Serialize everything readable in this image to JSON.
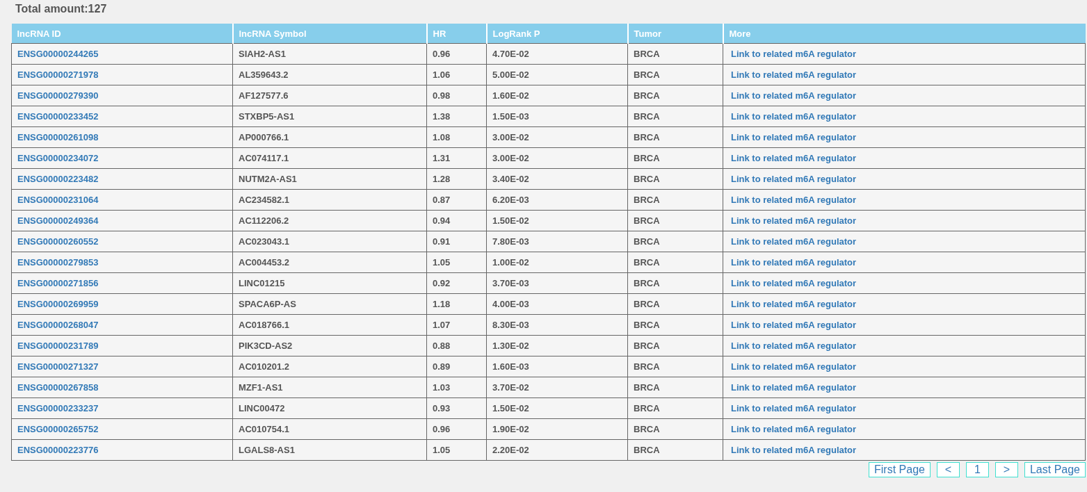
{
  "total_label": "Total amount:127",
  "table": {
    "columns": [
      "lncRNA ID",
      "lncRNA Symbol",
      "HR",
      "LogRank P",
      "Tumor",
      "More"
    ],
    "rows": [
      {
        "id": "ENSG00000244265",
        "symbol": "SIAH2-AS1",
        "hr": "0.96",
        "p": "4.70E-02",
        "tumor": "BRCA",
        "more": "Link to related m6A regulator"
      },
      {
        "id": "ENSG00000271978",
        "symbol": "AL359643.2",
        "hr": "1.06",
        "p": "5.00E-02",
        "tumor": "BRCA",
        "more": "Link to related m6A regulator"
      },
      {
        "id": "ENSG00000279390",
        "symbol": "AF127577.6",
        "hr": "0.98",
        "p": "1.60E-02",
        "tumor": "BRCA",
        "more": "Link to related m6A regulator"
      },
      {
        "id": "ENSG00000233452",
        "symbol": "STXBP5-AS1",
        "hr": "1.38",
        "p": "1.50E-03",
        "tumor": "BRCA",
        "more": "Link to related m6A regulator"
      },
      {
        "id": "ENSG00000261098",
        "symbol": "AP000766.1",
        "hr": "1.08",
        "p": "3.00E-02",
        "tumor": "BRCA",
        "more": "Link to related m6A regulator"
      },
      {
        "id": "ENSG00000234072",
        "symbol": "AC074117.1",
        "hr": "1.31",
        "p": "3.00E-02",
        "tumor": "BRCA",
        "more": "Link to related m6A regulator"
      },
      {
        "id": "ENSG00000223482",
        "symbol": "NUTM2A-AS1",
        "hr": "1.28",
        "p": "3.40E-02",
        "tumor": "BRCA",
        "more": "Link to related m6A regulator"
      },
      {
        "id": "ENSG00000231064",
        "symbol": "AC234582.1",
        "hr": "0.87",
        "p": "6.20E-03",
        "tumor": "BRCA",
        "more": "Link to related m6A regulator"
      },
      {
        "id": "ENSG00000249364",
        "symbol": "AC112206.2",
        "hr": "0.94",
        "p": "1.50E-02",
        "tumor": "BRCA",
        "more": "Link to related m6A regulator"
      },
      {
        "id": "ENSG00000260552",
        "symbol": "AC023043.1",
        "hr": "0.91",
        "p": "7.80E-03",
        "tumor": "BRCA",
        "more": "Link to related m6A regulator"
      },
      {
        "id": "ENSG00000279853",
        "symbol": "AC004453.2",
        "hr": "1.05",
        "p": "1.00E-02",
        "tumor": "BRCA",
        "more": "Link to related m6A regulator"
      },
      {
        "id": "ENSG00000271856",
        "symbol": "LINC01215",
        "hr": "0.92",
        "p": "3.70E-03",
        "tumor": "BRCA",
        "more": "Link to related m6A regulator"
      },
      {
        "id": "ENSG00000269959",
        "symbol": "SPACA6P-AS",
        "hr": "1.18",
        "p": "4.00E-03",
        "tumor": "BRCA",
        "more": "Link to related m6A regulator"
      },
      {
        "id": "ENSG00000268047",
        "symbol": "AC018766.1",
        "hr": "1.07",
        "p": "8.30E-03",
        "tumor": "BRCA",
        "more": "Link to related m6A regulator"
      },
      {
        "id": "ENSG00000231789",
        "symbol": "PIK3CD-AS2",
        "hr": "0.88",
        "p": "1.30E-02",
        "tumor": "BRCA",
        "more": "Link to related m6A regulator"
      },
      {
        "id": "ENSG00000271327",
        "symbol": "AC010201.2",
        "hr": "0.89",
        "p": "1.60E-03",
        "tumor": "BRCA",
        "more": "Link to related m6A regulator"
      },
      {
        "id": "ENSG00000267858",
        "symbol": "MZF1-AS1",
        "hr": "1.03",
        "p": "3.70E-02",
        "tumor": "BRCA",
        "more": "Link to related m6A regulator"
      },
      {
        "id": "ENSG00000233237",
        "symbol": "LINC00472",
        "hr": "0.93",
        "p": "1.50E-02",
        "tumor": "BRCA",
        "more": "Link to related m6A regulator"
      },
      {
        "id": "ENSG00000265752",
        "symbol": "AC010754.1",
        "hr": "0.96",
        "p": "1.90E-02",
        "tumor": "BRCA",
        "more": "Link to related m6A regulator"
      },
      {
        "id": "ENSG00000223776",
        "symbol": "LGALS8-AS1",
        "hr": "1.05",
        "p": "2.20E-02",
        "tumor": "BRCA",
        "more": "Link to related m6A regulator"
      }
    ]
  },
  "pagination": [
    "First Page",
    "<",
    "1",
    ">",
    "Last Page"
  ]
}
